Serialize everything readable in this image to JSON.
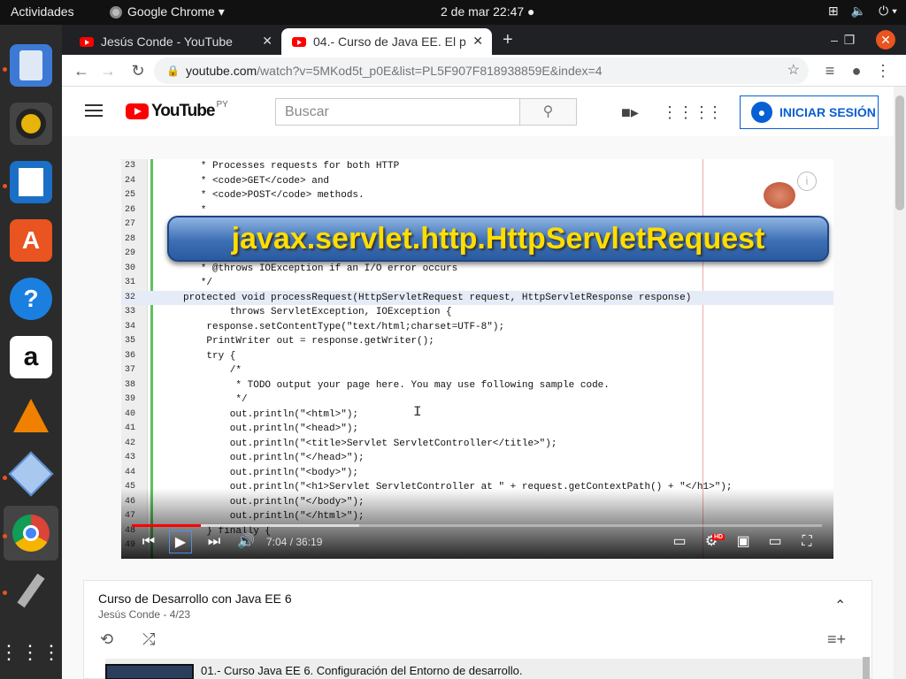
{
  "system": {
    "activities": "Actividades",
    "app_menu": "Google Chrome ▾",
    "clock": "2 de mar  22:47 ●"
  },
  "browser": {
    "tabs": [
      {
        "title": "Jesús Conde - YouTube"
      },
      {
        "title": "04.- Curso de Java EE. El p"
      }
    ],
    "new_tab": "+",
    "url_host": "youtube.com",
    "url_path": "/watch?v=5MKod5t_p0E&list=PL5F907F818938859E&index=4"
  },
  "youtube": {
    "logo_word": "YouTube",
    "region": "PY",
    "search_placeholder": "Buscar",
    "signin_label": "INICIAR SESIÓN",
    "brand_color": "#ff0000",
    "accent_color": "#065fd4"
  },
  "video": {
    "banner_text": "javax.servlet.http.HttpServletRequest",
    "time_current": "7:04",
    "time_total": "36:19",
    "progress_fraction": 0.1,
    "buffer_fraction": 0.33,
    "hd_badge": "HD",
    "code_lines": [
      {
        "n": "23",
        "text": "   * Processes requests for both HTTP",
        "cls": "c-com"
      },
      {
        "n": "24",
        "text": "   * <code>GET</code> and",
        "cls": "c-com"
      },
      {
        "n": "25",
        "text": "   * <code>POST</code> methods.",
        "cls": "c-com"
      },
      {
        "n": "26",
        "text": "   *",
        "cls": "c-com"
      },
      {
        "n": "27",
        "text": "",
        "cls": ""
      },
      {
        "n": "28",
        "text": "",
        "cls": ""
      },
      {
        "n": "29",
        "text": "",
        "cls": ""
      },
      {
        "n": "30",
        "text": "   * @throws IOException if an I/O error occurs",
        "cls": "c-com"
      },
      {
        "n": "31",
        "text": "   */",
        "cls": "c-com"
      },
      {
        "n": "32",
        "text": "protected void processRequest(HttpServletRequest request, HttpServletResponse response)",
        "cls": "c-kw",
        "hl": true
      },
      {
        "n": "33",
        "text": "        throws ServletException, IOException {",
        "cls": ""
      },
      {
        "n": "34",
        "text": "    response.setContentType(\"text/html;charset=UTF-8\");",
        "cls": ""
      },
      {
        "n": "35",
        "text": "    PrintWriter out = response.getWriter();",
        "cls": ""
      },
      {
        "n": "36",
        "text": "    try {",
        "cls": ""
      },
      {
        "n": "37",
        "text": "        /*",
        "cls": "c-com"
      },
      {
        "n": "38",
        "text": "         * TODO output your page here. You may use following sample code.",
        "cls": "c-com"
      },
      {
        "n": "39",
        "text": "         */",
        "cls": "c-com"
      },
      {
        "n": "40",
        "text": "        out.println(\"<html>\");",
        "cls": ""
      },
      {
        "n": "41",
        "text": "        out.println(\"<head>\");",
        "cls": ""
      },
      {
        "n": "42",
        "text": "        out.println(\"<title>Servlet ServletController</title>\");",
        "cls": ""
      },
      {
        "n": "43",
        "text": "        out.println(\"</head>\");",
        "cls": ""
      },
      {
        "n": "44",
        "text": "        out.println(\"<body>\");",
        "cls": ""
      },
      {
        "n": "45",
        "text": "        out.println(\"<h1>Servlet ServletController at \" + request.getContextPath() + \"</h1>\");",
        "cls": ""
      },
      {
        "n": "46",
        "text": "        out.println(\"</body>\");",
        "cls": ""
      },
      {
        "n": "47",
        "text": "        out.println(\"</html>\");",
        "cls": ""
      },
      {
        "n": "48",
        "text": "    } finally {",
        "cls": ""
      },
      {
        "n": "49",
        "text": "",
        "cls": ""
      }
    ]
  },
  "playlist": {
    "title": "Curso de Desarrollo con Java EE 6",
    "subtitle": "Jesús Conde - 4/23",
    "first_item": "01.- Curso Java EE 6. Configuración del Entorno de desarrollo."
  }
}
